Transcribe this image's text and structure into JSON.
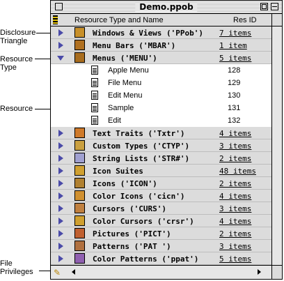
{
  "window": {
    "title": "Demo.ppob"
  },
  "header": {
    "name_col": "Resource Type and Name",
    "id_col": "Res ID"
  },
  "callouts": {
    "disclosure": "Disclosure\nTriangle",
    "resource_type": "Resource\nType",
    "resource": "Resource",
    "file_privileges": "File\nPrivileges"
  },
  "resources": [
    {
      "name": "Windows & Views ('PPob')",
      "count": "7 items",
      "icon": "ppob-icon",
      "open": false
    },
    {
      "name": "Menu Bars ('MBAR')",
      "count": "1 item",
      "icon": "mbar-icon",
      "open": false
    },
    {
      "name": "Menus ('MENU')",
      "count": "5 items",
      "icon": "menu-icon",
      "open": true,
      "items": [
        {
          "name": "Apple Menu",
          "id": "128"
        },
        {
          "name": "File Menu",
          "id": "129"
        },
        {
          "name": "Edit Menu",
          "id": "130"
        },
        {
          "name": "Sample",
          "id": "131"
        },
        {
          "name": "Edit",
          "id": "132"
        }
      ]
    },
    {
      "name": "Text Traits ('Txtr')",
      "count": "4 items",
      "icon": "txtr-icon",
      "open": false
    },
    {
      "name": "Custom Types ('CTYP')",
      "count": "3 items",
      "icon": "ctyp-icon",
      "open": false
    },
    {
      "name": "String Lists ('STR#')",
      "count": "2 items",
      "icon": "str-icon",
      "open": false
    },
    {
      "name": "Icon Suites",
      "count": "48 items",
      "icon": "icon-suite-icon",
      "open": false
    },
    {
      "name": "Icons ('ICON')",
      "count": "2 items",
      "icon": "icon-icon",
      "open": false
    },
    {
      "name": "Color Icons ('cicn')",
      "count": "4 items",
      "icon": "cicn-icon",
      "open": false
    },
    {
      "name": "Cursors ('CURS')",
      "count": "3 items",
      "icon": "curs-icon",
      "open": false
    },
    {
      "name": "Color Cursors ('crsr')",
      "count": "4 items",
      "icon": "crsr-icon",
      "open": false
    },
    {
      "name": "Pictures ('PICT')",
      "count": "2 items",
      "icon": "pict-icon",
      "open": false
    },
    {
      "name": "Patterns ('PAT ')",
      "count": "3 items",
      "icon": "pat-icon",
      "open": false
    },
    {
      "name": "Color Patterns ('ppat')",
      "count": "5 items",
      "icon": "ppat-icon",
      "open": false
    }
  ],
  "colors": {
    "triangle": "#4a4aa8",
    "row_gray": "#dcdcdc"
  }
}
